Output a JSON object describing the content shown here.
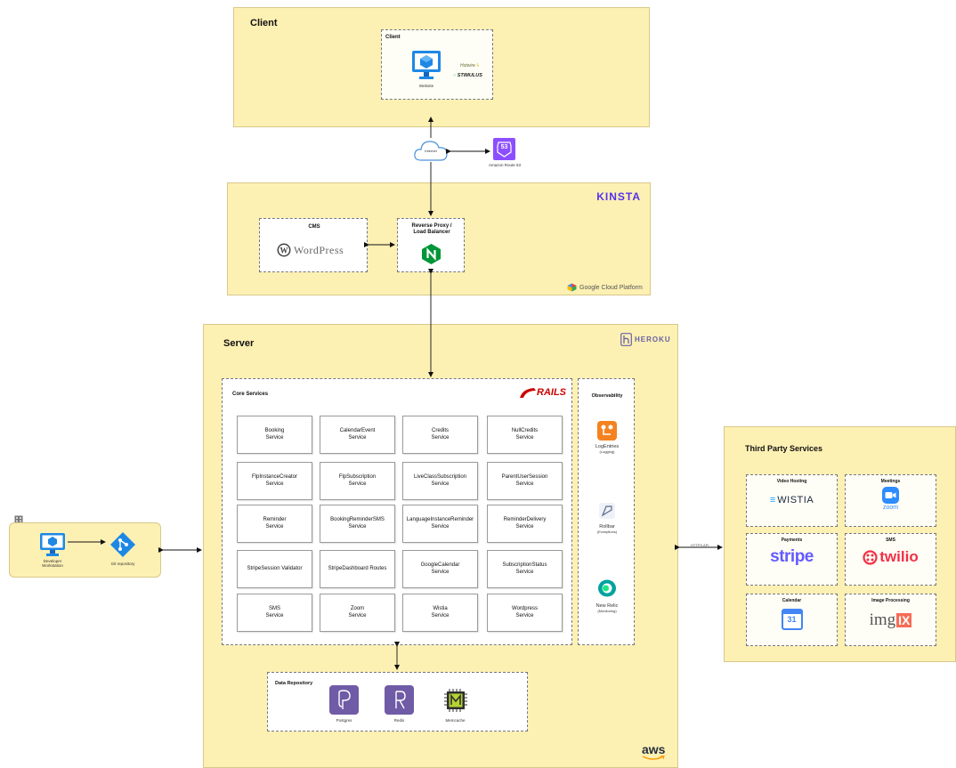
{
  "client": {
    "title": "Client",
    "inner_title": "Client",
    "website_label": "Website",
    "hotwire_label": "Hotwire",
    "stimulus_label": "STIMULUS"
  },
  "internet": {
    "label": "Internet"
  },
  "route53": {
    "label": "Amazon Route 53",
    "badge": "53"
  },
  "kinsta": {
    "brand": "KINSTA",
    "cms_title": "CMS",
    "wordpress_label": "WordPress",
    "proxy_title_1": "Reverse Proxy /",
    "proxy_title_2": "Load Balancer",
    "gcp_label": "Google Cloud Platform"
  },
  "server": {
    "title": "Server",
    "heroku_label": "HEROKU",
    "aws_label": "aws",
    "core_title": "Core Services",
    "rails_label": "RAILS",
    "services": [
      [
        "Booking",
        "Service"
      ],
      [
        "CalendarEvent",
        "Service"
      ],
      [
        "Credits",
        "Service"
      ],
      [
        "NullCredits",
        "Service"
      ],
      [
        "FlpInstanceCreator",
        "Service"
      ],
      [
        "FlpSubscription",
        "Service"
      ],
      [
        "LiveClassSubscription",
        "Service"
      ],
      [
        "ParentUserSession",
        "Service"
      ],
      [
        "Reminder",
        "Service"
      ],
      [
        "BookingReminderSMS",
        "Service"
      ],
      [
        "LanguageInstanceReminder",
        "Service"
      ],
      [
        "ReminderDelivery",
        "Service"
      ],
      [
        "StripeSession Validator",
        ""
      ],
      [
        "StripeDashboard Routes",
        ""
      ],
      [
        "GoogleCalendar",
        "Service"
      ],
      [
        "SubscriptionStatus",
        "Service"
      ],
      [
        "SMS",
        "Service"
      ],
      [
        "Zoom",
        "Service"
      ],
      [
        "Wistia",
        "Service"
      ],
      [
        "Wordpress",
        "Service"
      ]
    ],
    "observability": {
      "title": "Observability",
      "logentries": "LogEntries",
      "logentries_sub": "(Logging)",
      "rollbar": "Rollbar",
      "rollbar_sub": "(Exceptions)",
      "newrelic": "New Relic",
      "newrelic_sub": "(Monitoring)"
    },
    "data_repo": {
      "title": "Data Repository",
      "postgres": "Postgres",
      "redis": "Redis",
      "memcache": "Memcache"
    }
  },
  "dev": {
    "workstation_1": "Developer",
    "workstation_2": "Workstation",
    "git_label": "Git repository"
  },
  "third_party": {
    "title": "Third Party Services",
    "https_label": "HTTPS API",
    "video_title": "Video Hosting",
    "video_brand": "WISTIA",
    "meetings_title": "Meetings",
    "meetings_brand": "zoom",
    "payments_title": "Payments",
    "payments_brand": "stripe",
    "sms_title": "SMS",
    "sms_brand": "twilio",
    "calendar_title": "Calendar",
    "calendar_day": "31",
    "imgproc_title": "Image Processing",
    "imgproc_brand_1": "img",
    "imgproc_brand_2": "IX"
  },
  "colors": {
    "panel_fill": "#fdf0b3",
    "kinsta_purple": "#5333ed",
    "rails_red": "#cc0000",
    "heroku_purple": "#6762a6",
    "stripe_blue": "#635bff",
    "twilio_red": "#f22f46",
    "zoom_blue": "#2d8cff",
    "logentries_orange": "#f58220",
    "nginx_green": "#009639",
    "route53_purple": "#8c4fff"
  }
}
